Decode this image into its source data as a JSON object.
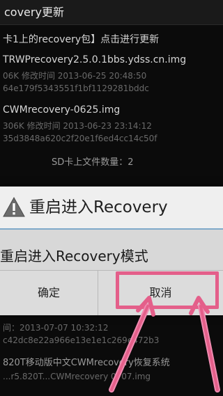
{
  "background": {
    "title": "covery更新",
    "items": [
      {
        "text": "卡1上的recovery包】点击进行更新"
      },
      {
        "text": "TRWPrecovery2.5.0.1bbs.ydss.cn.img"
      },
      {
        "text": "06K 修改时间 2013-06-25 20:48:50"
      },
      {
        "text": "64e179f5343551f1bf1129281bddc"
      },
      {
        "text": "CWMrecovery-0625.img"
      },
      {
        "text": "306K 修改时间 2013-06-23 23:14:12"
      },
      {
        "text": "35d3848a620c2f20e1f6ed4cc14c50f"
      },
      {
        "text": "SD卡上文件数量：2"
      },
      {
        "text": "间：2013-07-07 10:32:12"
      },
      {
        "text": "c42dc8e22a966e13e1e1c269e472b3"
      },
      {
        "text": "820T移动版中文CWMrecovery恢复系统"
      },
      {
        "text": "...r5.820T...CWMrecovery 0707.img"
      }
    ]
  },
  "dialog": {
    "title": "重启进入Recovery",
    "message": "重启进入Recovery模式",
    "ok_label": "确定",
    "cancel_label": "取消"
  },
  "colors": {
    "highlight": "#e45f8a",
    "dialog_accent": "#7ea9c9"
  }
}
